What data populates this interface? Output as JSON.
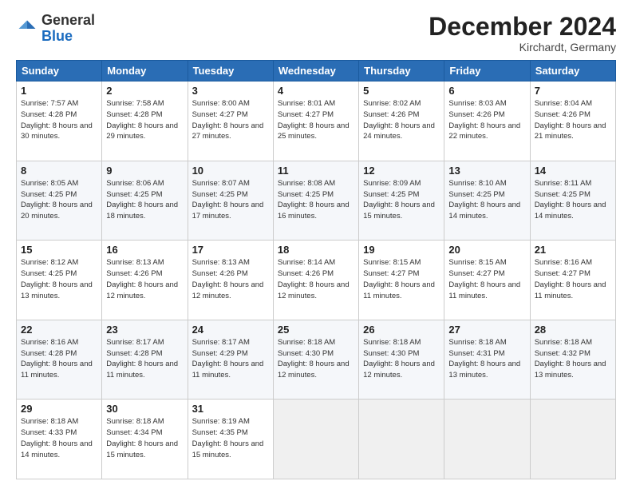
{
  "header": {
    "logo_general": "General",
    "logo_blue": "Blue",
    "month_title": "December 2024",
    "location": "Kirchardt, Germany"
  },
  "weekdays": [
    "Sunday",
    "Monday",
    "Tuesday",
    "Wednesday",
    "Thursday",
    "Friday",
    "Saturday"
  ],
  "weeks": [
    [
      {
        "day": "1",
        "sunrise": "7:57 AM",
        "sunset": "4:28 PM",
        "daylight": "8 hours and 30 minutes."
      },
      {
        "day": "2",
        "sunrise": "7:58 AM",
        "sunset": "4:28 PM",
        "daylight": "8 hours and 29 minutes."
      },
      {
        "day": "3",
        "sunrise": "8:00 AM",
        "sunset": "4:27 PM",
        "daylight": "8 hours and 27 minutes."
      },
      {
        "day": "4",
        "sunrise": "8:01 AM",
        "sunset": "4:27 PM",
        "daylight": "8 hours and 25 minutes."
      },
      {
        "day": "5",
        "sunrise": "8:02 AM",
        "sunset": "4:26 PM",
        "daylight": "8 hours and 24 minutes."
      },
      {
        "day": "6",
        "sunrise": "8:03 AM",
        "sunset": "4:26 PM",
        "daylight": "8 hours and 22 minutes."
      },
      {
        "day": "7",
        "sunrise": "8:04 AM",
        "sunset": "4:26 PM",
        "daylight": "8 hours and 21 minutes."
      }
    ],
    [
      {
        "day": "8",
        "sunrise": "8:05 AM",
        "sunset": "4:25 PM",
        "daylight": "8 hours and 20 minutes."
      },
      {
        "day": "9",
        "sunrise": "8:06 AM",
        "sunset": "4:25 PM",
        "daylight": "8 hours and 18 minutes."
      },
      {
        "day": "10",
        "sunrise": "8:07 AM",
        "sunset": "4:25 PM",
        "daylight": "8 hours and 17 minutes."
      },
      {
        "day": "11",
        "sunrise": "8:08 AM",
        "sunset": "4:25 PM",
        "daylight": "8 hours and 16 minutes."
      },
      {
        "day": "12",
        "sunrise": "8:09 AM",
        "sunset": "4:25 PM",
        "daylight": "8 hours and 15 minutes."
      },
      {
        "day": "13",
        "sunrise": "8:10 AM",
        "sunset": "4:25 PM",
        "daylight": "8 hours and 14 minutes."
      },
      {
        "day": "14",
        "sunrise": "8:11 AM",
        "sunset": "4:25 PM",
        "daylight": "8 hours and 14 minutes."
      }
    ],
    [
      {
        "day": "15",
        "sunrise": "8:12 AM",
        "sunset": "4:25 PM",
        "daylight": "8 hours and 13 minutes."
      },
      {
        "day": "16",
        "sunrise": "8:13 AM",
        "sunset": "4:26 PM",
        "daylight": "8 hours and 12 minutes."
      },
      {
        "day": "17",
        "sunrise": "8:13 AM",
        "sunset": "4:26 PM",
        "daylight": "8 hours and 12 minutes."
      },
      {
        "day": "18",
        "sunrise": "8:14 AM",
        "sunset": "4:26 PM",
        "daylight": "8 hours and 12 minutes."
      },
      {
        "day": "19",
        "sunrise": "8:15 AM",
        "sunset": "4:27 PM",
        "daylight": "8 hours and 11 minutes."
      },
      {
        "day": "20",
        "sunrise": "8:15 AM",
        "sunset": "4:27 PM",
        "daylight": "8 hours and 11 minutes."
      },
      {
        "day": "21",
        "sunrise": "8:16 AM",
        "sunset": "4:27 PM",
        "daylight": "8 hours and 11 minutes."
      }
    ],
    [
      {
        "day": "22",
        "sunrise": "8:16 AM",
        "sunset": "4:28 PM",
        "daylight": "8 hours and 11 minutes."
      },
      {
        "day": "23",
        "sunrise": "8:17 AM",
        "sunset": "4:28 PM",
        "daylight": "8 hours and 11 minutes."
      },
      {
        "day": "24",
        "sunrise": "8:17 AM",
        "sunset": "4:29 PM",
        "daylight": "8 hours and 11 minutes."
      },
      {
        "day": "25",
        "sunrise": "8:18 AM",
        "sunset": "4:30 PM",
        "daylight": "8 hours and 12 minutes."
      },
      {
        "day": "26",
        "sunrise": "8:18 AM",
        "sunset": "4:30 PM",
        "daylight": "8 hours and 12 minutes."
      },
      {
        "day": "27",
        "sunrise": "8:18 AM",
        "sunset": "4:31 PM",
        "daylight": "8 hours and 13 minutes."
      },
      {
        "day": "28",
        "sunrise": "8:18 AM",
        "sunset": "4:32 PM",
        "daylight": "8 hours and 13 minutes."
      }
    ],
    [
      {
        "day": "29",
        "sunrise": "8:18 AM",
        "sunset": "4:33 PM",
        "daylight": "8 hours and 14 minutes."
      },
      {
        "day": "30",
        "sunrise": "8:18 AM",
        "sunset": "4:34 PM",
        "daylight": "8 hours and 15 minutes."
      },
      {
        "day": "31",
        "sunrise": "8:19 AM",
        "sunset": "4:35 PM",
        "daylight": "8 hours and 15 minutes."
      },
      null,
      null,
      null,
      null
    ]
  ]
}
